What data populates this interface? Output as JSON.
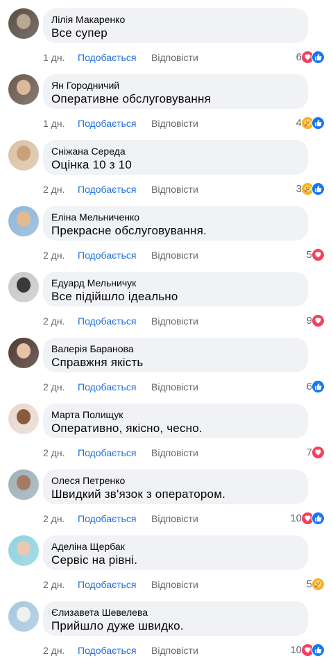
{
  "comments": [
    {
      "author": "Лілія Макаренко",
      "text": "Все супер",
      "time": "1 дн.",
      "like_label": "Подобається",
      "reply_label": "Відповісти",
      "reaction_count": "6",
      "reactions": [
        "heart",
        "like"
      ],
      "avatar_colors": [
        "#5a4e44",
        "#b8a892"
      ]
    },
    {
      "author": "Ян Городничий",
      "text": "Оперативне обслуговування",
      "time": "1 дн.",
      "like_label": "Подобається",
      "reply_label": "Відповісти",
      "reaction_count": "4",
      "reactions": [
        "care",
        "like"
      ],
      "avatar_colors": [
        "#6b5a4f",
        "#d9b99a"
      ]
    },
    {
      "author": "Сніжана Середа",
      "text": "Оцінка 10 з 10",
      "time": "2 дн.",
      "like_label": "Подобається",
      "reply_label": "Відповісти",
      "reaction_count": "3",
      "reactions": [
        "care",
        "like"
      ],
      "avatar_colors": [
        "#d9c3a5",
        "#caa17a"
      ]
    },
    {
      "author": "Еліна Мельниченко",
      "text": "Прекрасне обслуговування.",
      "time": "2 дн.",
      "like_label": "Подобається",
      "reply_label": "Відповісти",
      "reaction_count": "5",
      "reactions": [
        "heart"
      ],
      "avatar_colors": [
        "#8fb6d9",
        "#e3b98f"
      ]
    },
    {
      "author": "Едуард Мельничук",
      "text": "Все підійшло ідеально",
      "time": "2 дн.",
      "like_label": "Подобається",
      "reply_label": "Відповісти",
      "reaction_count": "9",
      "reactions": [
        "heart"
      ],
      "avatar_colors": [
        "#c9c9c9",
        "#3a3a3a"
      ]
    },
    {
      "author": "Валерія Баранова",
      "text": "Справжня якість",
      "time": "2 дн.",
      "like_label": "Подобається",
      "reply_label": "Відповісти",
      "reaction_count": "6",
      "reactions": [
        "like"
      ],
      "avatar_colors": [
        "#4f3b34",
        "#e6c2a6"
      ]
    },
    {
      "author": "Марта Полищук",
      "text": "Оперативно, якісно, чесно.",
      "time": "2 дн.",
      "like_label": "Подобається",
      "reply_label": "Відповісти",
      "reaction_count": "7",
      "reactions": [
        "heart"
      ],
      "avatar_colors": [
        "#e8d9cf",
        "#8a5a3c"
      ]
    },
    {
      "author": "Олеся Петренко",
      "text": "Швидкий зв'язок з оператором.",
      "time": "2 дн.",
      "like_label": "Подобається",
      "reply_label": "Відповісти",
      "reaction_count": "10",
      "reactions": [
        "heart",
        "like"
      ],
      "avatar_colors": [
        "#9fb0b8",
        "#a57a62"
      ]
    },
    {
      "author": "Аделіна Щербак",
      "text": "Сервіс на рівні.",
      "time": "2 дн.",
      "like_label": "Подобається",
      "reply_label": "Відповісти",
      "reaction_count": "5",
      "reactions": [
        "care"
      ],
      "avatar_colors": [
        "#8fd3e0",
        "#e8c7b5"
      ]
    },
    {
      "author": "Єлизавета Шевелева",
      "text": "Прийшло дуже швидко.",
      "time": "2 дн.",
      "like_label": "Подобається",
      "reply_label": "Відповісти",
      "reaction_count": "10",
      "reactions": [
        "heart",
        "like"
      ],
      "avatar_colors": [
        "#a7c8e0",
        "#f0f0f0"
      ]
    }
  ],
  "colors": {
    "bubble": "#f0f2f5",
    "like_link": "#216fdb",
    "meta": "#65676b",
    "heart": "#f3425f",
    "like": "#1877f2",
    "care": "#f7b125"
  }
}
